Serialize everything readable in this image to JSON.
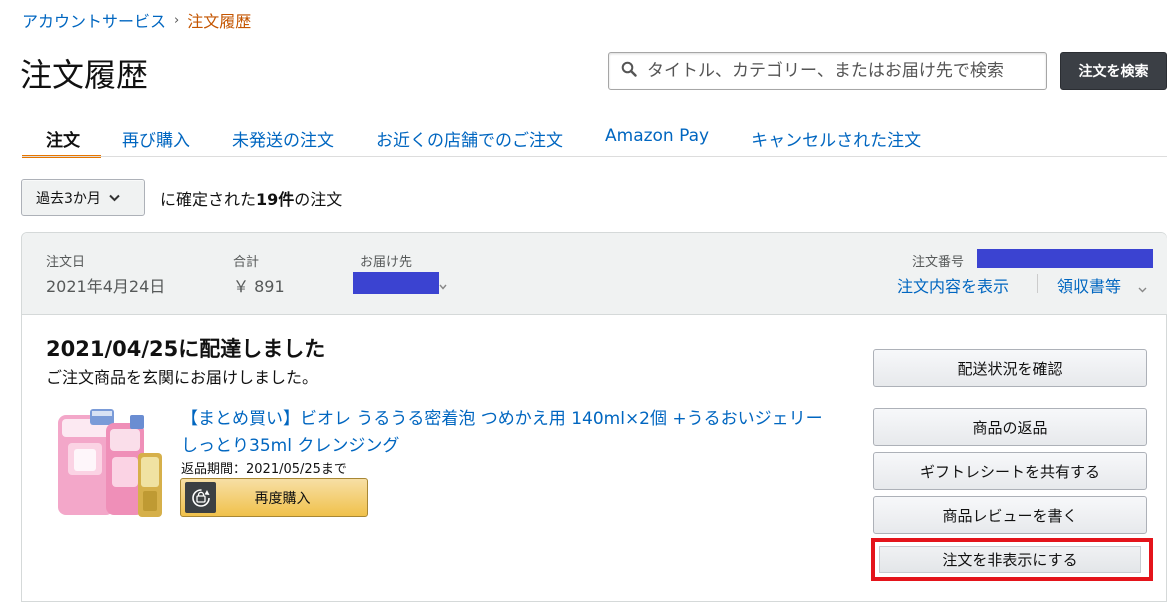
{
  "breadcrumb": {
    "parent": "アカウントサービス",
    "separator": "›",
    "current": "注文履歴"
  },
  "page": {
    "title": "注文履歴"
  },
  "search": {
    "placeholder": "タイトル、カテゴリー、またはお届け先で検索",
    "button_label": "注文を検索"
  },
  "tabs": [
    {
      "label": "注文",
      "active": true
    },
    {
      "label": "再び購入",
      "active": false
    },
    {
      "label": "未発送の注文",
      "active": false
    },
    {
      "label": "お近くの店舗でのご注文",
      "active": false
    },
    {
      "label": "Amazon Pay",
      "active": false
    },
    {
      "label": "キャンセルされた注文",
      "active": false
    }
  ],
  "filter": {
    "selected": "過去3か月",
    "prefix": "に確定された",
    "count": "19件",
    "suffix": "の注文"
  },
  "order": {
    "date_label": "注文日",
    "date_value": "2021年4月24日",
    "total_label": "合計",
    "total_value": "￥ 891",
    "ship_to_label": "お届け先",
    "order_number_label": "注文番号",
    "view_details": "注文内容を表示",
    "receipt": "領収書等",
    "status_title": "2021/04/25に配達しました",
    "status_sub": "ご注文商品を玄関にお届けしました。",
    "product_title": "【まとめ買い】ビオレ うるうる密着泡 つめかえ用 140ml×2個 +うるおいジェリーしっとり35ml クレンジング",
    "return_period": "返品期間：2021/05/25まで",
    "rebuy_label": "再度購入"
  },
  "actions": {
    "track": "配送状況を確認",
    "return": "商品の返品",
    "gift_receipt": "ギフトレシートを共有する",
    "review": "商品レビューを書く",
    "hide": "注文を非表示にする"
  },
  "colors": {
    "link": "#0066c0",
    "tab_active": "#e77600",
    "highlight": "#e4141b",
    "redaction": "#3b43d1"
  }
}
